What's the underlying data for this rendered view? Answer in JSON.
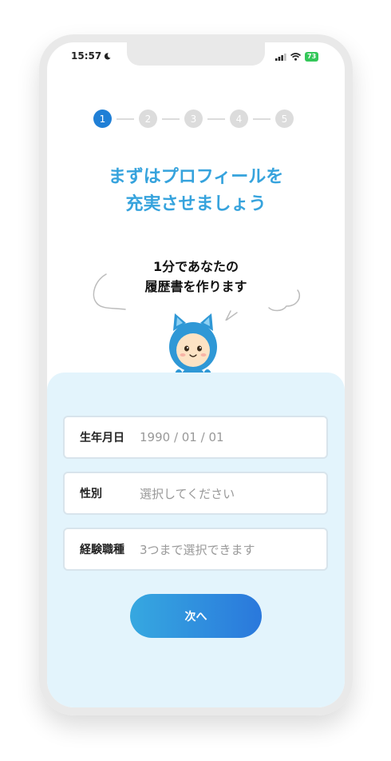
{
  "status_bar": {
    "time": "15:57",
    "battery": "73"
  },
  "steps": [
    "1",
    "2",
    "3",
    "4",
    "5"
  ],
  "title": {
    "line1": "まずはプロフィールを",
    "line2": "充実させましょう"
  },
  "speech": {
    "line1": "1分であなたの",
    "line2": "履歴書を作ります"
  },
  "form": {
    "birthdate": {
      "label": "生年月日",
      "placeholder": "1990 / 01 / 01"
    },
    "gender": {
      "label": "性別",
      "placeholder": "選択してください"
    },
    "occupation": {
      "label": "経験職種",
      "placeholder": "3つまで選択できます"
    }
  },
  "next_button": "次へ",
  "colors": {
    "accent": "#36a3dd",
    "active_step": "#1f7fd6",
    "panel_bg": "#e3f4fc",
    "button_start": "#36a8e0",
    "button_end": "#2a78dc"
  },
  "icons": {
    "moon": "moon-icon",
    "signal": "signal-icon",
    "wifi": "wifi-icon",
    "battery": "battery-icon"
  }
}
